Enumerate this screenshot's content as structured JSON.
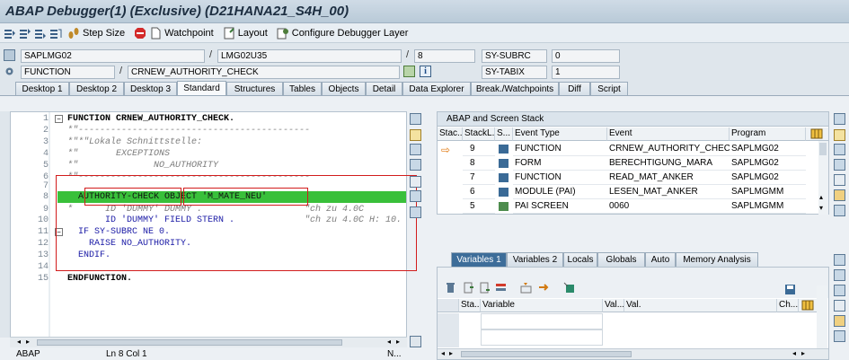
{
  "window": {
    "title": "ABAP Debugger(1)  (Exclusive) (D21HANA21_S4H_00)"
  },
  "toolbar": {
    "step_size": "Step Size",
    "watchpoint": "Watchpoint",
    "layout": "Layout",
    "configure": "Configure Debugger Layer"
  },
  "info": {
    "program": "SAPLMG02",
    "include": "LMG02U35",
    "line": "8",
    "subrc_label": "SY-SUBRC",
    "subrc_value": "0",
    "type": "FUNCTION",
    "name": "CRNEW_AUTHORITY_CHECK",
    "tabix_label": "SY-TABIX",
    "tabix_value": "1"
  },
  "tabs": [
    "Desktop 1",
    "Desktop 2",
    "Desktop 3",
    "Standard",
    "Structures",
    "Tables",
    "Objects",
    "Detail",
    "Data Explorer",
    "Break./Watchpoints",
    "Diff",
    "Script"
  ],
  "active_tab": "Standard",
  "code": {
    "lines": [
      {
        "n": "1",
        "text": "FUNCTION CRNEW_AUTHORITY_CHECK."
      },
      {
        "n": "2",
        "text": "*\"-------------------------------------------"
      },
      {
        "n": "3",
        "text": "*\"*\"Lokale Schnittstelle:"
      },
      {
        "n": "4",
        "text": "*\"       EXCEPTIONS"
      },
      {
        "n": "5",
        "text": "*\"              NO_AUTHORITY"
      },
      {
        "n": "6",
        "text": "*\"-------------------------------------------"
      },
      {
        "n": "7",
        "text": ""
      },
      {
        "n": "8",
        "text": "  AUTHORITY-CHECK OBJECT 'M_MATE_NEU'"
      },
      {
        "n": "9",
        "text": "*      ID 'DUMMY' DUMMY ."
      },
      {
        "n": "10",
        "text": "       ID 'DUMMY' FIELD STERN ."
      },
      {
        "n": "11",
        "text": "  IF SY-SUBRC NE 0."
      },
      {
        "n": "12",
        "text": "    RAISE NO_AUTHORITY."
      },
      {
        "n": "13",
        "text": "  ENDIF."
      },
      {
        "n": "14",
        "text": ""
      },
      {
        "n": "15",
        "text": "ENDFUNCTION."
      }
    ],
    "comment_9": "\"ch zu 4.0C",
    "comment_10": "\"ch zu 4.0C H: 10."
  },
  "editor_status": {
    "lang": "ABAP",
    "pos": "Ln  8 Col  1",
    "mode": "N..."
  },
  "stack": {
    "title": "ABAP and Screen Stack",
    "headers": [
      "Stac...",
      "StackL...",
      "S...",
      "Event Type",
      "Event",
      "Program"
    ],
    "rows": [
      {
        "level": "9",
        "type": "FUNCTION",
        "event": "CRNEW_AUTHORITY_CHECK",
        "program": "SAPLMG02",
        "current": true
      },
      {
        "level": "8",
        "type": "FORM",
        "event": "BERECHTIGUNG_MARA",
        "program": "SAPLMG02",
        "current": false
      },
      {
        "level": "7",
        "type": "FUNCTION",
        "event": "READ_MAT_ANKER",
        "program": "SAPLMG02",
        "current": false
      },
      {
        "level": "6",
        "type": "MODULE (PAI)",
        "event": "LESEN_MAT_ANKER",
        "program": "SAPLMGMM",
        "current": false
      },
      {
        "level": "5",
        "type": "PAI SCREEN",
        "event": "0060",
        "program": "SAPLMGMM",
        "current": false
      }
    ]
  },
  "vartabs": [
    "Variables 1",
    "Variables 2",
    "Locals",
    "Globals",
    "Auto",
    "Memory Analysis"
  ],
  "vars": {
    "headers": [
      "Sta...",
      "Variable",
      "Val...",
      "Val.",
      "Ch..."
    ]
  },
  "colors": {
    "accent": "#3d6d99",
    "exec_line": "#39c03a",
    "annotation": "#d21c1c"
  }
}
